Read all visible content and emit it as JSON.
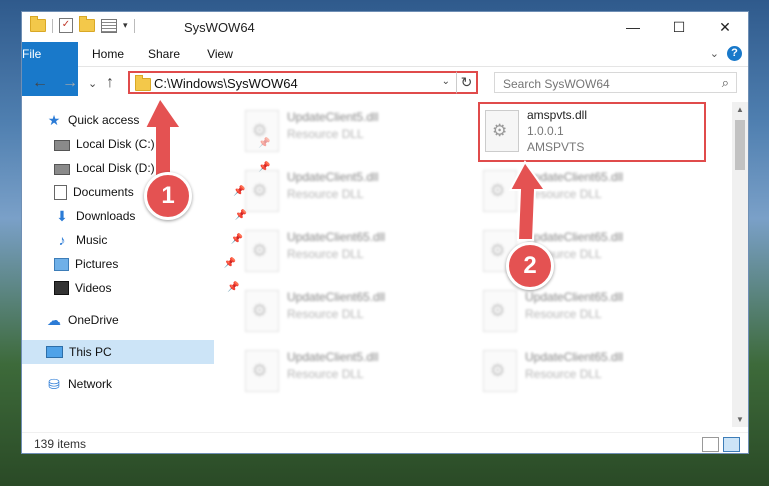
{
  "window": {
    "title": "SysWOW64",
    "controls": {
      "minimize": "—",
      "maximize": "☐",
      "close": "✕"
    }
  },
  "ribbon": {
    "tabs": [
      "File",
      "Home",
      "Share",
      "View"
    ],
    "expand": "⌄",
    "help": "?"
  },
  "nav": {
    "back": "←",
    "forward": "→",
    "recent": "⌄",
    "up": "↑",
    "address": "C:\\Windows\\SysWOW64",
    "address_dropdown": "⌄",
    "refresh": "↻",
    "search_placeholder": "Search SysWOW64",
    "search_icon": "⌕"
  },
  "sidebar": {
    "items": [
      {
        "label": "Quick access",
        "icon": "star-icon",
        "glyph": "★"
      },
      {
        "label": "Local Disk (C:)",
        "icon": "drive-icon",
        "glyph": ""
      },
      {
        "label": "Local Disk (D:)",
        "icon": "drive-icon",
        "glyph": ""
      },
      {
        "label": "Documents",
        "icon": "documents-icon",
        "glyph": ""
      },
      {
        "label": "Downloads",
        "icon": "download-icon",
        "glyph": "⬇"
      },
      {
        "label": "Music",
        "icon": "music-icon",
        "glyph": "♪"
      },
      {
        "label": "Pictures",
        "icon": "pictures-icon",
        "glyph": ""
      },
      {
        "label": "Videos",
        "icon": "videos-icon",
        "glyph": ""
      },
      {
        "label": "OneDrive",
        "icon": "cloud-icon",
        "glyph": "☁"
      },
      {
        "label": "This PC",
        "icon": "pc-icon",
        "glyph": ""
      },
      {
        "label": "Network",
        "icon": "network-icon",
        "glyph": "⛁"
      }
    ],
    "pin_glyph": "📌"
  },
  "files": {
    "left_column": [
      {
        "name": "UpdateClient5.dll",
        "sub": "Resource DLL"
      },
      {
        "name": "UpdateClient5.dll",
        "sub": "Resource DLL"
      },
      {
        "name": "UpdateClient65.dll",
        "sub": "Resource DLL"
      },
      {
        "name": "UpdateClient65.dll",
        "sub": "Resource DLL"
      },
      {
        "name": "UpdateClient5.dll",
        "sub": "Resource DLL"
      }
    ],
    "right_column": [
      {
        "name": "amspvts.dll",
        "sub": "1.0.0.1",
        "sub2": "AMSPVTS"
      },
      {
        "name": "UpdateClient65.dll",
        "sub": "Resource DLL"
      },
      {
        "name": "UpdateClient65.dll",
        "sub": "Resource DLL"
      },
      {
        "name": "UpdateClient65.dll",
        "sub": "Resource DLL"
      },
      {
        "name": "UpdateClient65.dll",
        "sub": "Resource DLL"
      }
    ]
  },
  "status": {
    "item_count": "139 items"
  },
  "callouts": [
    "1",
    "2"
  ],
  "colors": {
    "accent": "#1979ca",
    "highlight": "#e04b4b"
  }
}
